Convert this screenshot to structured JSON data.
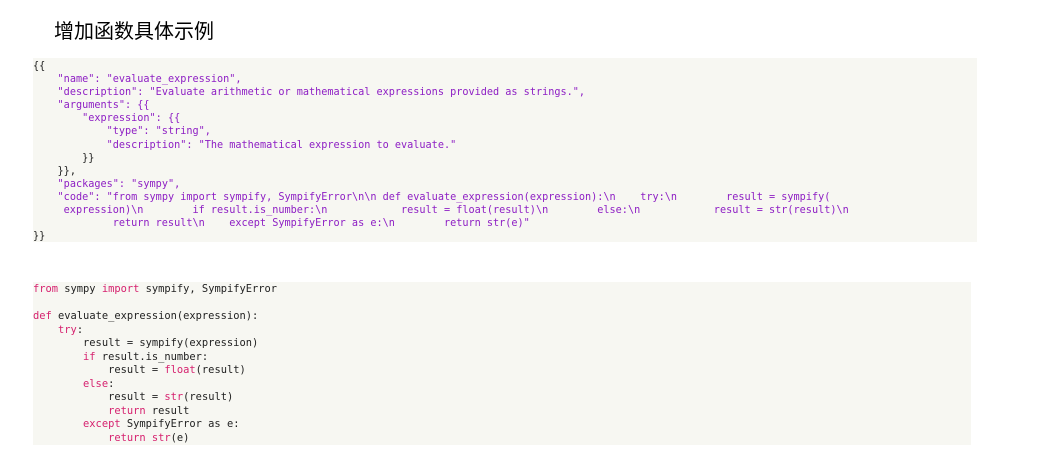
{
  "page": {
    "heading": "增加函数具体示例"
  },
  "json_block": {
    "lines": [
      {
        "indent": "",
        "parts": [
          {
            "t": "{{",
            "c": "dark"
          }
        ]
      },
      {
        "indent": "    ",
        "parts": [
          {
            "t": "\"name\": \"evaluate_expression\",",
            "c": "purple"
          }
        ]
      },
      {
        "indent": "    ",
        "parts": [
          {
            "t": "\"description\": \"Evaluate arithmetic or mathematical expressions provided as strings.\",",
            "c": "purple"
          }
        ]
      },
      {
        "indent": "    ",
        "parts": [
          {
            "t": "\"arguments\": {{",
            "c": "purple"
          }
        ]
      },
      {
        "indent": "        ",
        "parts": [
          {
            "t": "\"expression\": {{",
            "c": "purple"
          }
        ]
      },
      {
        "indent": "            ",
        "parts": [
          {
            "t": "\"type\": \"string\",",
            "c": "purple"
          }
        ]
      },
      {
        "indent": "            ",
        "parts": [
          {
            "t": "\"description\": \"The mathematical expression to evaluate.\"",
            "c": "purple"
          }
        ]
      },
      {
        "indent": "        ",
        "parts": [
          {
            "t": "}}",
            "c": "dark"
          }
        ]
      },
      {
        "indent": "    ",
        "parts": [
          {
            "t": "}},",
            "c": "dark"
          }
        ]
      },
      {
        "indent": "    ",
        "parts": [
          {
            "t": "\"packages\": \"sympy\",",
            "c": "purple"
          }
        ]
      },
      {
        "indent": "    ",
        "parts": [
          {
            "t": "\"code\": \"from sympy import sympify, SympifyError\\n\\n def evaluate_expression(expression):\\n    try:\\n        result = sympify(",
            "c": "purple"
          }
        ]
      },
      {
        "indent": "     ",
        "parts": [
          {
            "t": "expression)\\n        if result.is_number:\\n            result = float(result)\\n        else:\\n            result = str(result)\\n",
            "c": "purple"
          }
        ]
      },
      {
        "indent": "             ",
        "parts": [
          {
            "t": "return result\\n    except SympifyError as e:\\n        return str(e)\"",
            "c": "purple"
          }
        ]
      },
      {
        "indent": "",
        "parts": [
          {
            "t": "}}",
            "c": "dark"
          }
        ]
      }
    ]
  },
  "python_block": {
    "lines": [
      {
        "indent": "",
        "parts": [
          {
            "t": "from",
            "c": "kw"
          },
          {
            "t": " sympy ",
            "c": "dark"
          },
          {
            "t": "import",
            "c": "kw"
          },
          {
            "t": " sympify, SympifyError",
            "c": "dark"
          }
        ]
      },
      {
        "indent": "",
        "parts": [
          {
            "t": "",
            "c": "dark"
          }
        ]
      },
      {
        "indent": "",
        "parts": [
          {
            "t": "def",
            "c": "kw"
          },
          {
            "t": " evaluate_expression(expression):",
            "c": "dark"
          }
        ]
      },
      {
        "indent": "    ",
        "parts": [
          {
            "t": "try",
            "c": "kw"
          },
          {
            "t": ":",
            "c": "dark"
          }
        ]
      },
      {
        "indent": "        ",
        "parts": [
          {
            "t": "result = sympify(expression)",
            "c": "dark"
          }
        ]
      },
      {
        "indent": "        ",
        "parts": [
          {
            "t": "if",
            "c": "kw"
          },
          {
            "t": " result.is_number:",
            "c": "dark"
          }
        ]
      },
      {
        "indent": "            ",
        "parts": [
          {
            "t": "result = ",
            "c": "dark"
          },
          {
            "t": "float",
            "c": "kw"
          },
          {
            "t": "(result)",
            "c": "dark"
          }
        ]
      },
      {
        "indent": "        ",
        "parts": [
          {
            "t": "else",
            "c": "kw"
          },
          {
            "t": ":",
            "c": "dark"
          }
        ]
      },
      {
        "indent": "            ",
        "parts": [
          {
            "t": "result = ",
            "c": "dark"
          },
          {
            "t": "str",
            "c": "kw"
          },
          {
            "t": "(result)",
            "c": "dark"
          }
        ]
      },
      {
        "indent": "            ",
        "parts": [
          {
            "t": "return",
            "c": "kw"
          },
          {
            "t": " result",
            "c": "dark"
          }
        ]
      },
      {
        "indent": "        ",
        "parts": [
          {
            "t": "except",
            "c": "kw"
          },
          {
            "t": " SympifyError as e:",
            "c": "dark"
          }
        ]
      },
      {
        "indent": "            ",
        "parts": [
          {
            "t": "return",
            "c": "kw"
          },
          {
            "t": " ",
            "c": "dark"
          },
          {
            "t": "str",
            "c": "kw"
          },
          {
            "t": "(e)",
            "c": "dark"
          }
        ]
      }
    ]
  },
  "colors": {
    "json_string": "#8e1fc4",
    "keyword": "#d6226f",
    "code_text": "#222222",
    "code_background": "#f7f7f2"
  }
}
